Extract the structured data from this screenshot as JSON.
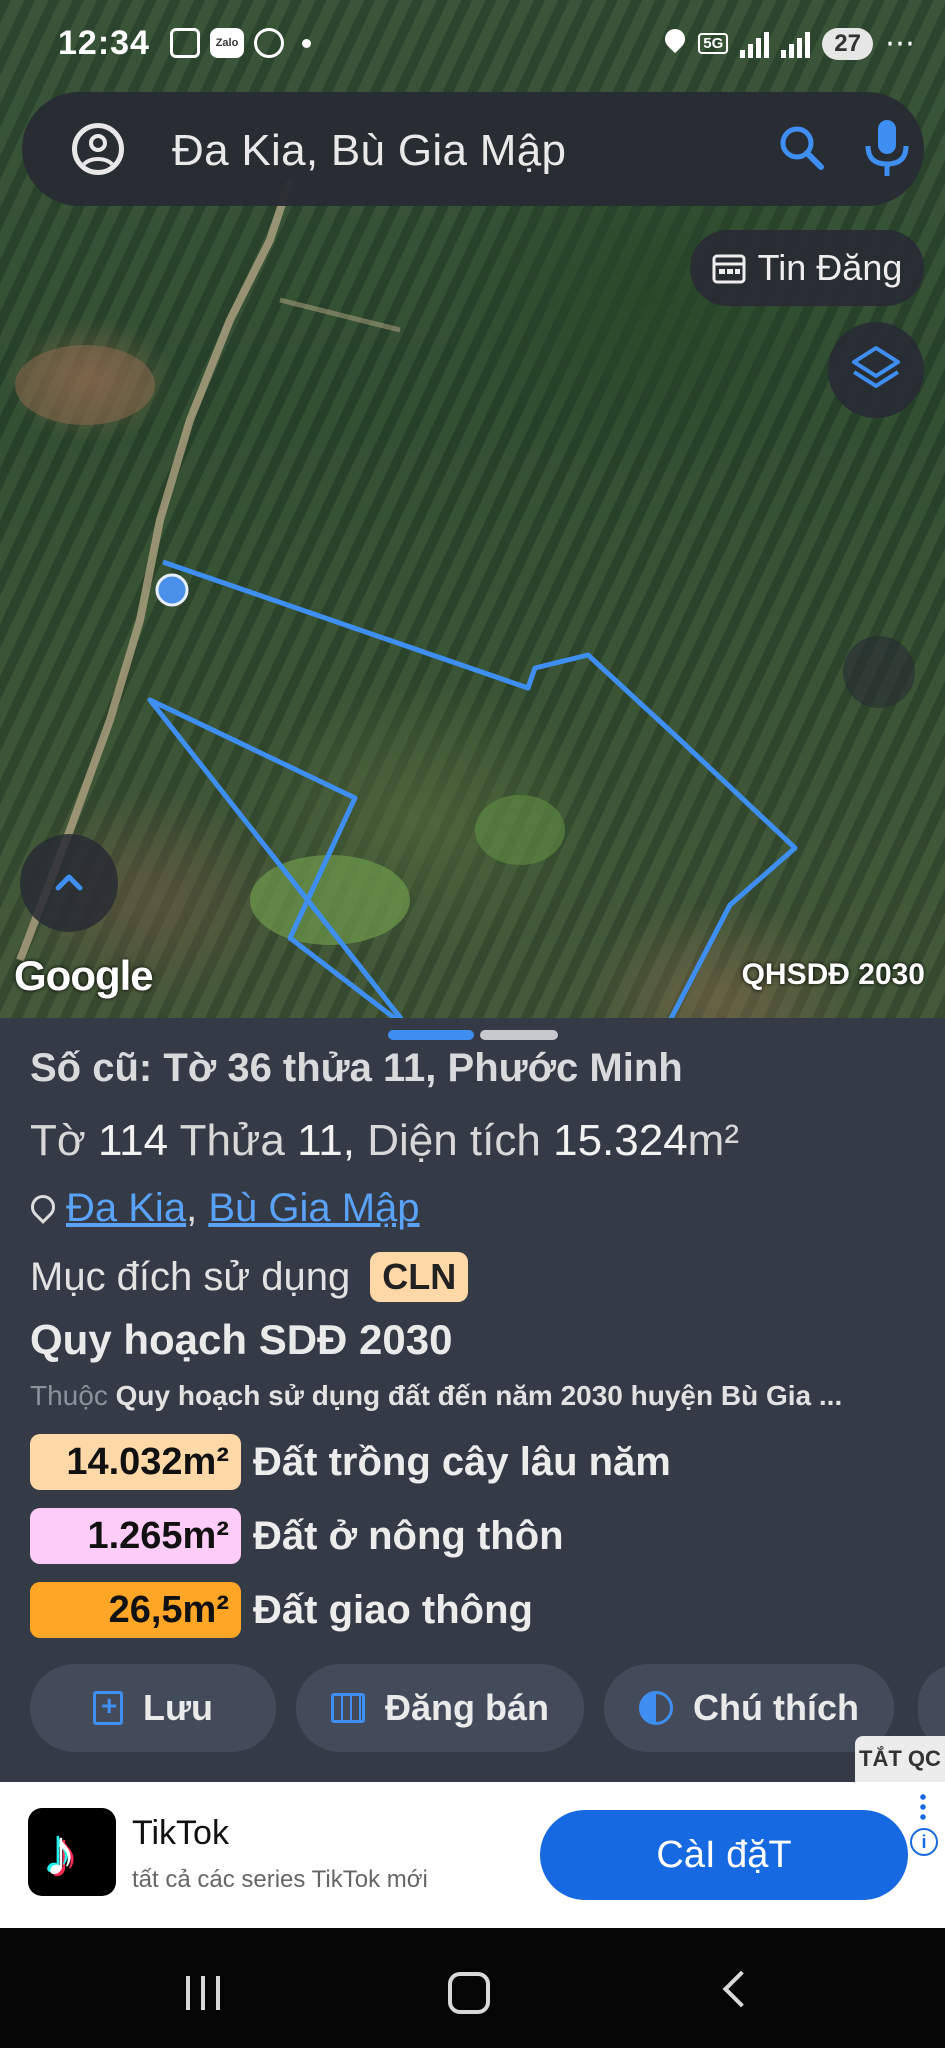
{
  "status_bar": {
    "time": "12:34",
    "zalo_label": "Zalo",
    "network": "5G",
    "battery": "27",
    "more": "⋯"
  },
  "search": {
    "query": "Đa Kia, Bù Gia Mập"
  },
  "map": {
    "tin_dang_label": "Tin Đăng",
    "google_label": "Google",
    "overlay_tag": "QHSDĐ 2030",
    "parcel_outline_color": "#3f8ff2"
  },
  "details": {
    "old_number": "Số cũ: Tờ 36 thửa 11, Phước Minh",
    "parcel": {
      "to_label": "Tờ",
      "to_value": "114",
      "thua_label": "Thửa",
      "thua_value": "11,",
      "area_label": "Diện tích",
      "area_value": "15.324",
      "area_unit": "m²"
    },
    "location": {
      "commune": "Đa Kia",
      "separator": ",",
      "district": "Bù Gia Mập"
    },
    "purpose_label": "Mục đích sử dụng",
    "purpose_code": "CLN",
    "plan_title": "Quy hoạch SDĐ 2030",
    "plan_prefix": "Thuộc",
    "plan_desc": "Quy hoạch sử dụng đất đến năm 2030 huyện Bù Gia ...",
    "areas": [
      {
        "value": "14.032m²",
        "label": "Đất trồng cây lâu năm",
        "color": "#ffd8a8"
      },
      {
        "value": "1.265m²",
        "label": "Đất ở nông thôn",
        "color": "#fdcdf8"
      },
      {
        "value": "26,5m²",
        "label": "Đất giao thông",
        "color": "#ffa627"
      }
    ]
  },
  "actions": [
    {
      "label": "Lưu",
      "icon": "file-plus-icon"
    },
    {
      "label": "Đăng bán",
      "icon": "calendar-icon"
    },
    {
      "label": "Chú thích",
      "icon": "contrast-icon"
    }
  ],
  "ad": {
    "close_tag": "TẮT QC",
    "app_name": "TikTok",
    "subtitle": "tất cả các series TikTok mới",
    "install_label": "CàI đặT",
    "info_label": "i"
  }
}
